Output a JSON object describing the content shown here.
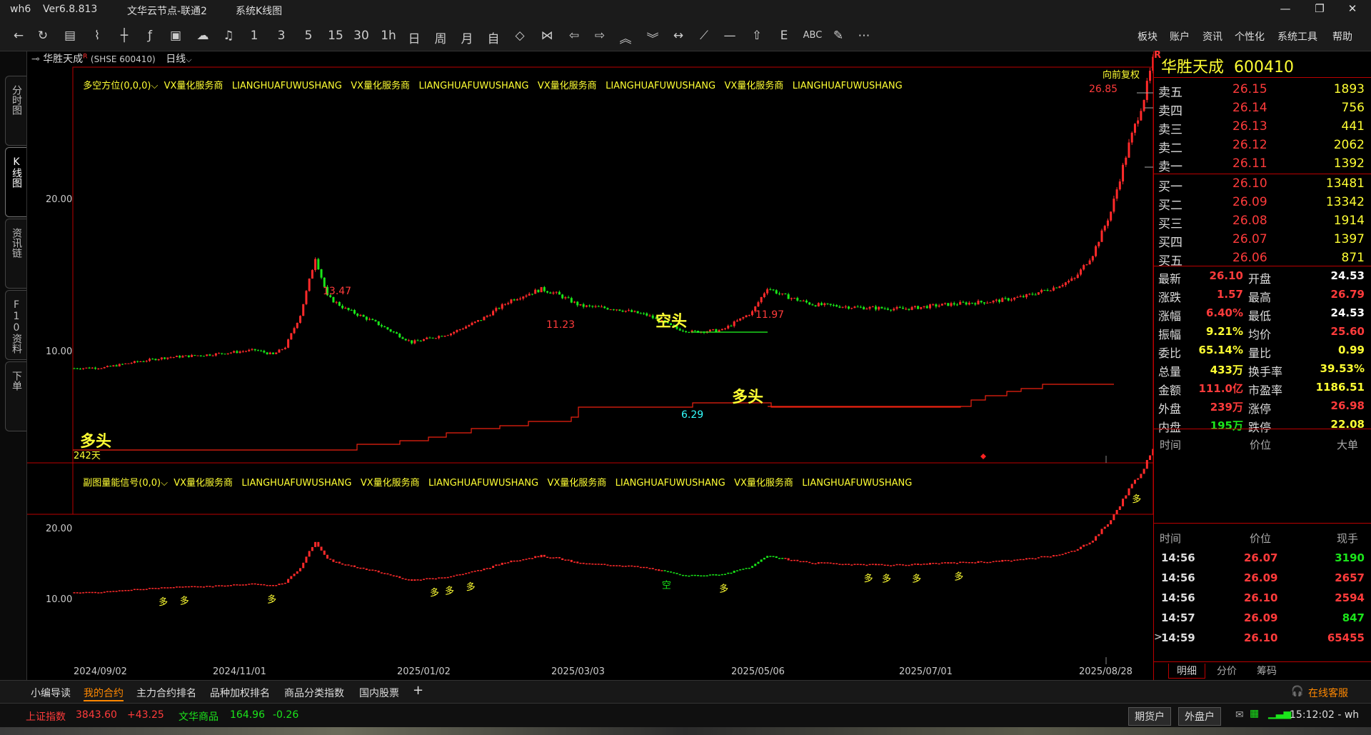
{
  "titlebar": {
    "app": "wh6",
    "version": "Ver6.8.813",
    "server": "文华云节点-联通2",
    "page": "系统K线图"
  },
  "toolbar": {
    "buttons": [
      "1",
      "3",
      "5",
      "15",
      "30",
      "1h",
      "日",
      "周",
      "月",
      "自",
      "ABC"
    ],
    "menus": [
      "板块",
      "账户",
      "资讯",
      "个性化",
      "系统工具",
      "帮助"
    ]
  },
  "leftbar": {
    "tabs": [
      "分时图",
      "K线图",
      "资讯链",
      "F10资料",
      "下单"
    ]
  },
  "chart": {
    "symbol_name": "华胜天成",
    "symbol_code": "(SHSE 600410)",
    "period": "日线",
    "main_indicator": "多空方位(0,0,0)",
    "sub_indicator": "副图量能信号(0,0)",
    "ad": "VX量化服务商   LIANGHUAFUWUSHANG   VX量化服务商   LIANGHUAFUWUSHANG   VX量化服务商   LIANGHUAFUWUSHANG   VX量化服务商   LIANGHUAFUWUSHANG",
    "sub_ad": "VX量化服务商   LIANGHUAFUWUSHANG   VX量化服务商   LIANGHUAFUWUSHANG   VX量化服务商   LIANGHUAFUWUSHANG   VX量化服务商   LIANGHUAFUWUSHANG",
    "adjust": "向前复权",
    "main_y_labels": [
      "20.00",
      "10.00"
    ],
    "sub_y_labels": [
      "20.00",
      "10.00"
    ],
    "x_labels": [
      "2024/09/02",
      "2024/11/01",
      "2025/01/02",
      "2025/03/03",
      "2025/05/06",
      "2025/07/01",
      "2025/08/28"
    ],
    "price_labels": {
      "p1": "13.47",
      "p2": "11.23",
      "p3": "11.97",
      "p4": "6.29",
      "p5": "26.85"
    },
    "signals": {
      "duo1": "多头",
      "kong": "空头",
      "duo2": "多头",
      "days": "242天"
    },
    "sub_marks": {
      "duo": "多",
      "kong": "空"
    }
  },
  "chart_data": {
    "type": "candlestick",
    "ylim": [
      4,
      28
    ],
    "labeled_points": [
      {
        "date": "2024/10/22",
        "high": 13.47
      },
      {
        "date": "2025/03/10",
        "high": 11.23
      },
      {
        "date": "2025/05/06",
        "high": 11.97
      },
      {
        "date": "2025/04/09",
        "low": 6.29
      },
      {
        "date": "2025/08/28",
        "high": 26.85
      }
    ]
  },
  "quote": {
    "title": "华胜天成  600410",
    "badge": "R",
    "asks": [
      {
        "label": "卖五",
        "price": "26.15",
        "vol": "1893"
      },
      {
        "label": "卖四",
        "price": "26.14",
        "vol": "756"
      },
      {
        "label": "卖三",
        "price": "26.13",
        "vol": "441"
      },
      {
        "label": "卖二",
        "price": "26.12",
        "vol": "2062"
      },
      {
        "label": "卖一",
        "price": "26.11",
        "vol": "1392"
      }
    ],
    "bids": [
      {
        "label": "买一",
        "price": "26.10",
        "vol": "13481"
      },
      {
        "label": "买二",
        "price": "26.09",
        "vol": "13342"
      },
      {
        "label": "买三",
        "price": "26.08",
        "vol": "1914"
      },
      {
        "label": "买四",
        "price": "26.07",
        "vol": "1397"
      },
      {
        "label": "买五",
        "price": "26.06",
        "vol": "871"
      }
    ],
    "stats": [
      {
        "l1": "最新",
        "v1": "26.10",
        "c1": "red",
        "l2": "开盘",
        "v2": "24.53",
        "c2": "wht"
      },
      {
        "l1": "涨跌",
        "v1": "1.57",
        "c1": "red",
        "l2": "最高",
        "v2": "26.79",
        "c2": "red"
      },
      {
        "l1": "涨幅",
        "v1": "6.40%",
        "c1": "red",
        "l2": "最低",
        "v2": "24.53",
        "c2": "wht"
      },
      {
        "l1": "振幅",
        "v1": "9.21%",
        "c1": "yel",
        "l2": "均价",
        "v2": "25.60",
        "c2": "red"
      },
      {
        "l1": "委比",
        "v1": "65.14%",
        "c1": "yel",
        "l2": "量比",
        "v2": "0.99",
        "c2": "yel"
      },
      {
        "l1": "总量",
        "v1": "433万",
        "c1": "yel",
        "l2": "换手率",
        "v2": "39.53%",
        "c2": "yel"
      },
      {
        "l1": "金额",
        "v1": "111.0亿",
        "c1": "red",
        "l2": "市盈率",
        "v2": "1186.51",
        "c2": "yel"
      },
      {
        "l1": "外盘",
        "v1": "239万",
        "c1": "red",
        "l2": "涨停",
        "v2": "26.98",
        "c2": "red"
      },
      {
        "l1": "内盘",
        "v1": "195万",
        "c1": "grn",
        "l2": "跌停",
        "v2": "22.08",
        "c2": "yel"
      }
    ],
    "big_header": [
      "时间",
      "价位",
      "大单"
    ],
    "tick_header": [
      "时间",
      "价位",
      "现手"
    ],
    "ticks": [
      {
        "t": "14:56",
        "p": "26.07",
        "v": "3190",
        "vc": "grn"
      },
      {
        "t": "14:56",
        "p": "26.09",
        "v": "2657",
        "vc": "red"
      },
      {
        "t": "14:56",
        "p": "26.10",
        "v": "2594",
        "vc": "red"
      },
      {
        "t": "14:57",
        "p": "26.09",
        "v": "847",
        "vc": "grn"
      },
      {
        "t": "14:59",
        "p": "26.10",
        "v": "65455",
        "vc": "red"
      }
    ],
    "tick_prefix": ">",
    "tabs": [
      "明细",
      "分价",
      "筹码"
    ]
  },
  "bottom": {
    "tabs": [
      "小编导读",
      "我的合约",
      "主力合约排名",
      "品种加权排名",
      "商品分类指数",
      "国内股票"
    ],
    "add": "+",
    "service": "在线客服"
  },
  "status": {
    "idx1_name": "上证指数",
    "idx1_val": "3843.60",
    "idx1_chg": "+43.25",
    "idx2_name": "文华商品",
    "idx2_val": "164.96",
    "idx2_chg": "-0.26",
    "futures": "期货户",
    "stocks": "外盘户",
    "time": "15:12:02 - wh"
  }
}
